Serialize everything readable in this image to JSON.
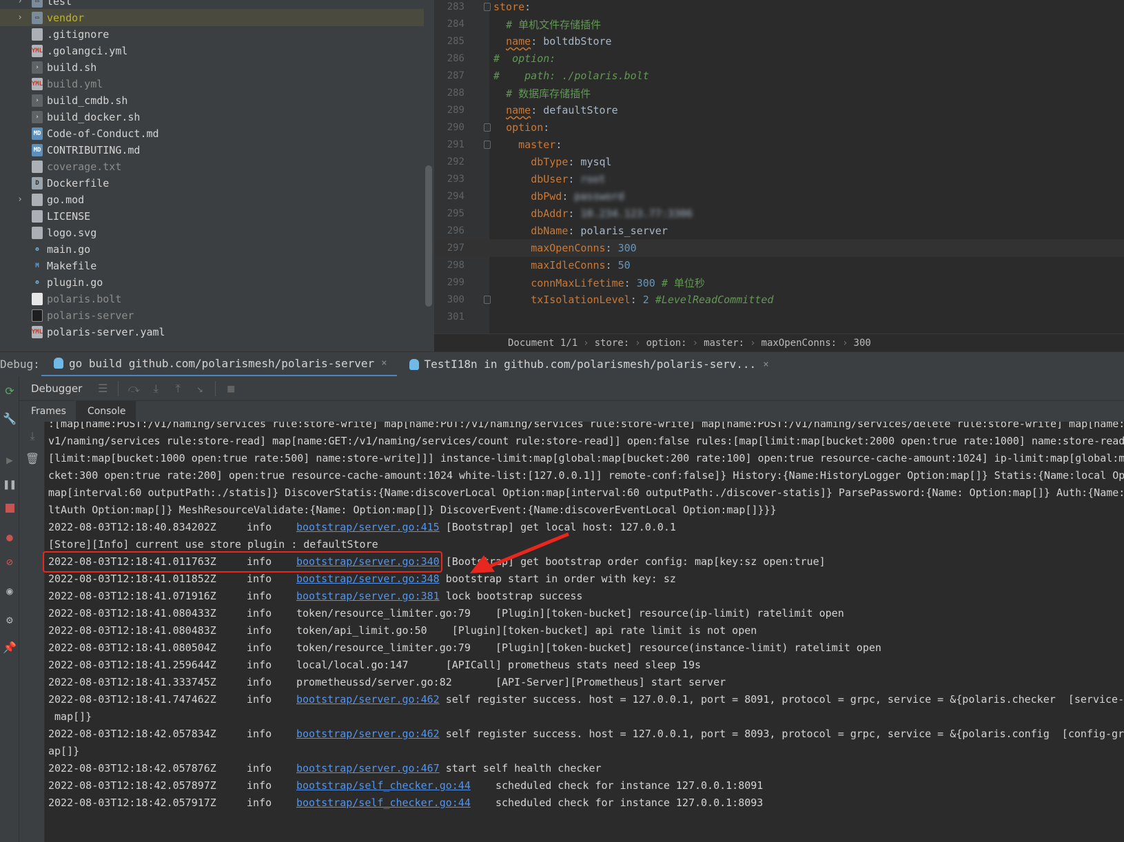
{
  "tree": {
    "items": [
      {
        "name": "test",
        "icon": "folder-icon",
        "expandable": true,
        "style": "normal"
      },
      {
        "name": "vendor",
        "icon": "folder-icon",
        "expandable": true,
        "style": "vendor"
      },
      {
        "name": ".gitignore",
        "icon": "text-file-icon",
        "expandable": false,
        "style": "normal"
      },
      {
        "name": ".golangci.yml",
        "icon": "yml-file-icon",
        "expandable": false,
        "style": "normal"
      },
      {
        "name": "build.sh",
        "icon": "shell-file-icon",
        "expandable": false,
        "style": "normal"
      },
      {
        "name": "build.yml",
        "icon": "yml-file-icon",
        "expandable": false,
        "style": "dim"
      },
      {
        "name": "build_cmdb.sh",
        "icon": "shell-file-icon",
        "expandable": false,
        "style": "normal"
      },
      {
        "name": "build_docker.sh",
        "icon": "shell-file-icon",
        "expandable": false,
        "style": "normal"
      },
      {
        "name": "Code-of-Conduct.md",
        "icon": "markdown-file-icon",
        "expandable": false,
        "style": "normal"
      },
      {
        "name": "CONTRIBUTING.md",
        "icon": "markdown-file-icon",
        "expandable": false,
        "style": "normal"
      },
      {
        "name": "coverage.txt",
        "icon": "text-file-icon",
        "expandable": false,
        "style": "dim"
      },
      {
        "name": "Dockerfile",
        "icon": "docker-file-icon",
        "expandable": false,
        "style": "normal"
      },
      {
        "name": "go.mod",
        "icon": "text-file-icon",
        "expandable": true,
        "style": "normal"
      },
      {
        "name": "LICENSE",
        "icon": "text-file-icon",
        "expandable": false,
        "style": "normal"
      },
      {
        "name": "logo.svg",
        "icon": "text-file-icon",
        "expandable": false,
        "style": "normal"
      },
      {
        "name": "main.go",
        "icon": "go-file-icon",
        "expandable": false,
        "style": "normal"
      },
      {
        "name": "Makefile",
        "icon": "makefile-icon",
        "expandable": false,
        "style": "normal"
      },
      {
        "name": "plugin.go",
        "icon": "go-file-icon",
        "expandable": false,
        "style": "normal"
      },
      {
        "name": "polaris.bolt",
        "icon": "plain-file-icon",
        "expandable": false,
        "style": "dim"
      },
      {
        "name": "polaris-server",
        "icon": "binary-file-icon",
        "expandable": false,
        "style": "dim"
      },
      {
        "name": "polaris-server.yaml",
        "icon": "yml-file-icon",
        "expandable": false,
        "style": "normal"
      }
    ]
  },
  "editor": {
    "lines": [
      {
        "num": "283",
        "html": "<span class=\"k\">store</span><span class=\"v\">:</span>",
        "fold": true
      },
      {
        "num": "284",
        "html": "  <span class=\"c\"># 单机文件存储插件</span>",
        "fold": false
      },
      {
        "num": "285",
        "html": "  <span class=\"k wavy\">name</span><span class=\"v\">: boltdbStore</span>",
        "fold": false
      },
      {
        "num": "286",
        "html": "<span class=\"ci\">#  option:</span>",
        "fold": false
      },
      {
        "num": "287",
        "html": "<span class=\"ci\">#    path: ./polaris.bolt</span>",
        "fold": false
      },
      {
        "num": "288",
        "html": "  <span class=\"c\"># 数据库存储插件</span>",
        "fold": false
      },
      {
        "num": "289",
        "html": "  <span class=\"k wavy\">name</span><span class=\"v\">: defaultStore</span>",
        "fold": false
      },
      {
        "num": "290",
        "html": "  <span class=\"k\">option</span><span class=\"v\">:</span>",
        "fold": true
      },
      {
        "num": "291",
        "html": "    <span class=\"k\">master</span><span class=\"v\">:</span>",
        "fold": true
      },
      {
        "num": "292",
        "html": "      <span class=\"k\">dbType</span><span class=\"v\">: mysql</span>",
        "fold": false
      },
      {
        "num": "293",
        "html": "      <span class=\"k\">dbUser</span><span class=\"v\">: </span><span class=\"blur\">root</span>",
        "fold": false
      },
      {
        "num": "294",
        "html": "      <span class=\"k\">dbPwd</span><span class=\"v\">: </span><span class=\"blur\">password</span>",
        "fold": false
      },
      {
        "num": "295",
        "html": "      <span class=\"k\">dbAddr</span><span class=\"v\">: </span><span class=\"blur\">10.234.123.77:3306</span>",
        "fold": false
      },
      {
        "num": "296",
        "html": "      <span class=\"k\">dbName</span><span class=\"v\">: polaris_server</span>",
        "fold": false
      },
      {
        "num": "297",
        "html": "      <span class=\"k\">maxOpenConns</span><span class=\"v\">: </span><span class=\"n\">300</span>",
        "fold": false,
        "current": true
      },
      {
        "num": "298",
        "html": "      <span class=\"k\">maxIdleConns</span><span class=\"v\">: </span><span class=\"n\">50</span>",
        "fold": false
      },
      {
        "num": "299",
        "html": "      <span class=\"k\">connMaxLifetime</span><span class=\"v\">: </span><span class=\"n\">300</span> <span class=\"c\"># 单位秒</span>",
        "fold": false
      },
      {
        "num": "300",
        "html": "      <span class=\"k\">txIsolationLevel</span><span class=\"v\">: </span><span class=\"n\">2</span> <span class=\"ci\">#LevelReadCommitted</span>",
        "fold": true
      },
      {
        "num": "301",
        "html": "",
        "fold": false
      }
    ],
    "breadcrumb": [
      "Document 1/1",
      "store:",
      "option:",
      "master:",
      "maxOpenConns:",
      "300"
    ]
  },
  "debug": {
    "label": "Debug:",
    "tabs": [
      {
        "label": "go build github.com/polarismesh/polaris-server",
        "active": true
      },
      {
        "label": "TestI18n in github.com/polarismesh/polaris-serv...",
        "active": false
      }
    ],
    "toolbar_title": "Debugger",
    "subtabs": [
      {
        "label": "Frames",
        "active": false
      },
      {
        "label": "Console",
        "active": true
      }
    ]
  },
  "console": {
    "lines": [
      {
        "type": "raw",
        "text": ":[map[name:POST:/v1/naming/services rule:store-write] map[name:PUT:/v1/naming/services rule:store-write] map[name:POST:/v1/naming/services/delete rule:store-write] map[name:G"
      },
      {
        "type": "raw",
        "text": "v1/naming/services rule:store-read] map[name:GET:/v1/naming/services/count rule:store-read]] open:false rules:[map[limit:map[bucket:2000 open:true rate:1000] name:store-read]"
      },
      {
        "type": "raw",
        "text": "[limit:map[bucket:1000 open:true rate:500] name:store-write]]] instance-limit:map[global:map[bucket:200 rate:100] open:true resource-cache-amount:1024] ip-limit:map[global:ma"
      },
      {
        "type": "raw",
        "text": "cket:300 open:true rate:200] open:true resource-cache-amount:1024 white-list:[127.0.0.1]] remote-conf:false]} History:{Name:HistoryLogger Option:map[]} Statis:{Name:local Opti"
      },
      {
        "type": "raw",
        "text": "map[interval:60 outputPath:./statis]} DiscoverStatis:{Name:discoverLocal Option:map[interval:60 outputPath:./discover-statis]} ParsePassword:{Name: Option:map[]} Auth:{Name:de"
      },
      {
        "type": "raw",
        "text": "ltAuth Option:map[]} MeshResourceValidate:{Name: Option:map[]} DiscoverEvent:{Name:discoverEventLocal Option:map[]}}}"
      },
      {
        "type": "log",
        "ts": "2022-08-03T12:18:40.834202Z",
        "lvl": "info",
        "src": "bootstrap/server.go:415",
        "link": true,
        "msg": " [Bootstrap] get local host: 127.0.0.1"
      },
      {
        "type": "raw",
        "text": "[Store][Info] current use store plugin : defaultStore"
      },
      {
        "type": "log",
        "ts": "2022-08-03T12:18:41.011763Z",
        "lvl": "info",
        "src": "bootstrap/server.go:340",
        "link": true,
        "msg": " [Bootstrap] get bootstrap order config: map[key:sz open:true]"
      },
      {
        "type": "log",
        "ts": "2022-08-03T12:18:41.011852Z",
        "lvl": "info",
        "src": "bootstrap/server.go:348",
        "link": true,
        "msg": " bootstrap start in order with key: sz"
      },
      {
        "type": "log",
        "ts": "2022-08-03T12:18:41.071916Z",
        "lvl": "info",
        "src": "bootstrap/server.go:381",
        "link": true,
        "msg": " lock bootstrap success"
      },
      {
        "type": "log",
        "ts": "2022-08-03T12:18:41.080433Z",
        "lvl": "info",
        "src": "token/resource_limiter.go:79",
        "link": false,
        "msg": "    [Plugin][token-bucket] resource(ip-limit) ratelimit open"
      },
      {
        "type": "log",
        "ts": "2022-08-03T12:18:41.080483Z",
        "lvl": "info",
        "src": "token/api_limit.go:50",
        "link": false,
        "msg": "    [Plugin][token-bucket] api rate limit is not open"
      },
      {
        "type": "log",
        "ts": "2022-08-03T12:18:41.080504Z",
        "lvl": "info",
        "src": "token/resource_limiter.go:79",
        "link": false,
        "msg": "    [Plugin][token-bucket] resource(instance-limit) ratelimit open"
      },
      {
        "type": "log",
        "ts": "2022-08-03T12:18:41.259644Z",
        "lvl": "info",
        "src": "local/local.go:147",
        "link": false,
        "msg": "      [APICall] prometheus stats need sleep 19s"
      },
      {
        "type": "log",
        "ts": "2022-08-03T12:18:41.333745Z",
        "lvl": "info",
        "src": "prometheussd/server.go:82",
        "link": false,
        "msg": "       [API-Server][Prometheus] start server"
      },
      {
        "type": "log",
        "ts": "2022-08-03T12:18:41.747462Z",
        "lvl": "info",
        "src": "bootstrap/server.go:462",
        "link": true,
        "msg": " self register success. host = 127.0.0.1, port = 8091, protocol = grpc, service = &{polaris.checker  [service-g"
      },
      {
        "type": "raw",
        "text": " map[]}"
      },
      {
        "type": "log",
        "ts": "2022-08-03T12:18:42.057834Z",
        "lvl": "info",
        "src": "bootstrap/server.go:462",
        "link": true,
        "msg": " self register success. host = 127.0.0.1, port = 8093, protocol = grpc, service = &{polaris.config  [config-grp"
      },
      {
        "type": "raw",
        "text": "ap[]}"
      },
      {
        "type": "log",
        "ts": "2022-08-03T12:18:42.057876Z",
        "lvl": "info",
        "src": "bootstrap/server.go:467",
        "link": true,
        "msg": " start self health checker"
      },
      {
        "type": "log",
        "ts": "2022-08-03T12:18:42.057897Z",
        "lvl": "info",
        "src": "bootstrap/self_checker.go:44",
        "link": true,
        "msg": "    scheduled check for instance 127.0.0.1:8091"
      },
      {
        "type": "log",
        "ts": "2022-08-03T12:18:42.057917Z",
        "lvl": "info",
        "src": "bootstrap/self_checker.go:44",
        "link": true,
        "msg": "    scheduled check for instance 127.0.0.1:8093"
      }
    ]
  },
  "annotation": {
    "color": "#e8271e"
  }
}
